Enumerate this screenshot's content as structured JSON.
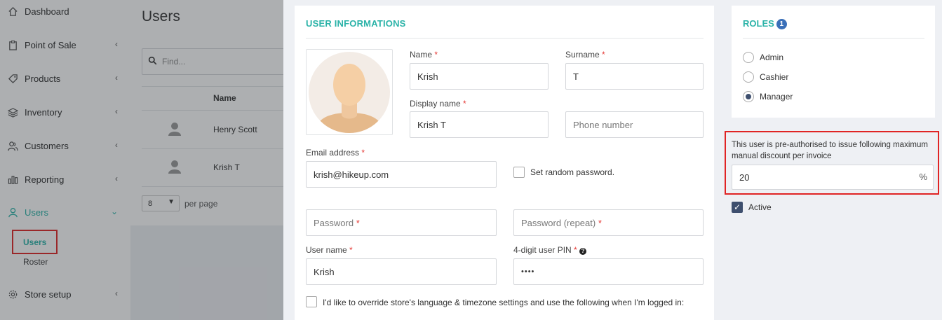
{
  "sidebar": {
    "items": [
      {
        "label": "Dashboard",
        "icon": "home-icon"
      },
      {
        "label": "Point of Sale",
        "icon": "clipboard-icon"
      },
      {
        "label": "Products",
        "icon": "tag-icon"
      },
      {
        "label": "Inventory",
        "icon": "layers-icon"
      },
      {
        "label": "Customers",
        "icon": "users-icon"
      },
      {
        "label": "Reporting",
        "icon": "bar-chart-icon"
      },
      {
        "label": "Users",
        "icon": "user-icon"
      },
      {
        "label": "Store setup",
        "icon": "gear-icon"
      }
    ],
    "sub_items": [
      "Users",
      "Roster"
    ]
  },
  "users_list": {
    "title": "Users",
    "search_placeholder": "Find...",
    "column_name": "Name",
    "rows": [
      "Henry Scott",
      "Krish T"
    ],
    "per_page_value": "8",
    "per_page_label": "per page"
  },
  "form": {
    "section_title": "USER INFORMATIONS",
    "name_label": "Name",
    "name_value": "Krish",
    "surname_label": "Surname",
    "surname_value": "T",
    "display_name_label": "Display name",
    "display_name_value": "Krish T",
    "phone_placeholder": "Phone number",
    "email_label": "Email address",
    "email_value": "krish@hikeup.com",
    "random_password_label": "Set random password.",
    "password_placeholder": "Password",
    "password_repeat_placeholder": "Password (repeat)",
    "username_label": "User name",
    "username_value": "Krish",
    "pin_label": "4-digit user PIN",
    "pin_value": "••••",
    "override_label": "I'd like to override store's language & timezone settings and use the following when I'm logged in:",
    "required_mark": "*"
  },
  "roles": {
    "title": "ROLES",
    "count": "1",
    "options": [
      "Admin",
      "Cashier",
      "Manager"
    ],
    "selected": "Manager"
  },
  "discount": {
    "text": "This user is pre-authorised to issue following maximum manual discount per invoice",
    "value": "20",
    "unit": "%"
  },
  "active": {
    "label": "Active",
    "checked": true
  },
  "colors": {
    "accent": "#2bb3a8",
    "highlight_border": "#e02424",
    "checkbox_fill": "#3e4f6e"
  }
}
